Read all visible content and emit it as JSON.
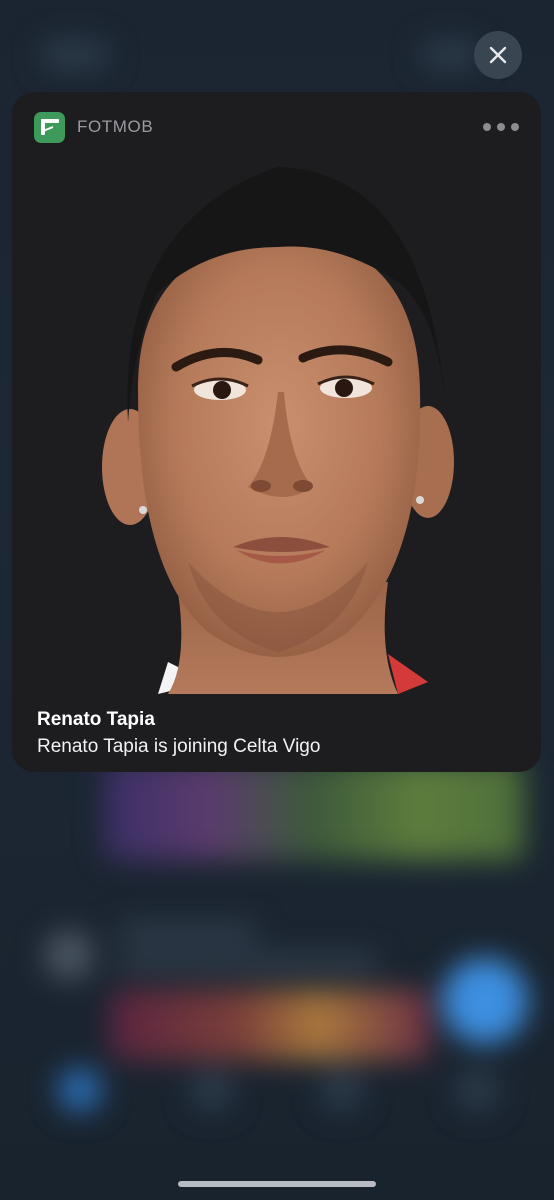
{
  "notification": {
    "app_name": "FOTMOB",
    "app_icon": "fotmob-logo-icon",
    "title": "Renato Tapia",
    "body": "Renato Tapia is joining Celta Vigo",
    "image": "player-portrait"
  },
  "controls": {
    "close_icon": "close-icon",
    "more_icon": "more-options-icon"
  },
  "colors": {
    "card_background": "#1d1d20",
    "app_icon_green": "#3e9a5b",
    "accent_blue": "#3d8fe0"
  }
}
